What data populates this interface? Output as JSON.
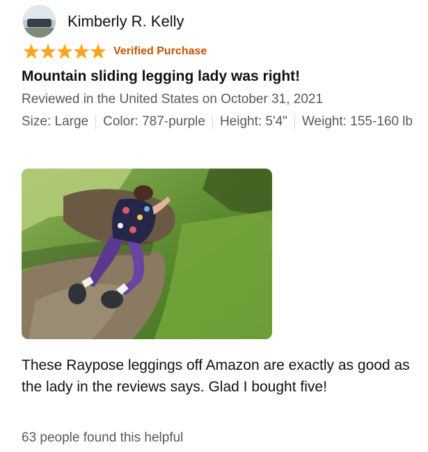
{
  "reviewer": {
    "name": "Kimberly R. Kelly",
    "avatar_icon": "profile-photo"
  },
  "rating": {
    "stars": 5,
    "max": 5,
    "color": "#ffa41c"
  },
  "verified_label": "Verified Purchase",
  "title": "Mountain sliding legging lady was right!",
  "review_date": "Reviewed in the United States on October 31, 2021",
  "attributes": {
    "size": "Size: Large",
    "color": "Color: 787-purple",
    "height": "Height: 5'4\"",
    "weight": "Weight: 155-160 lb"
  },
  "photo": {
    "icon": "review-photo"
  },
  "body": "These Raypose leggings off Amazon are exactly as good as the lady in the reviews says. Glad I bought five!",
  "helpful": "63 people found this helpful",
  "colors": {
    "verified": "#c45500",
    "secondary_text": "#565959",
    "primary_text": "#0f1111"
  }
}
